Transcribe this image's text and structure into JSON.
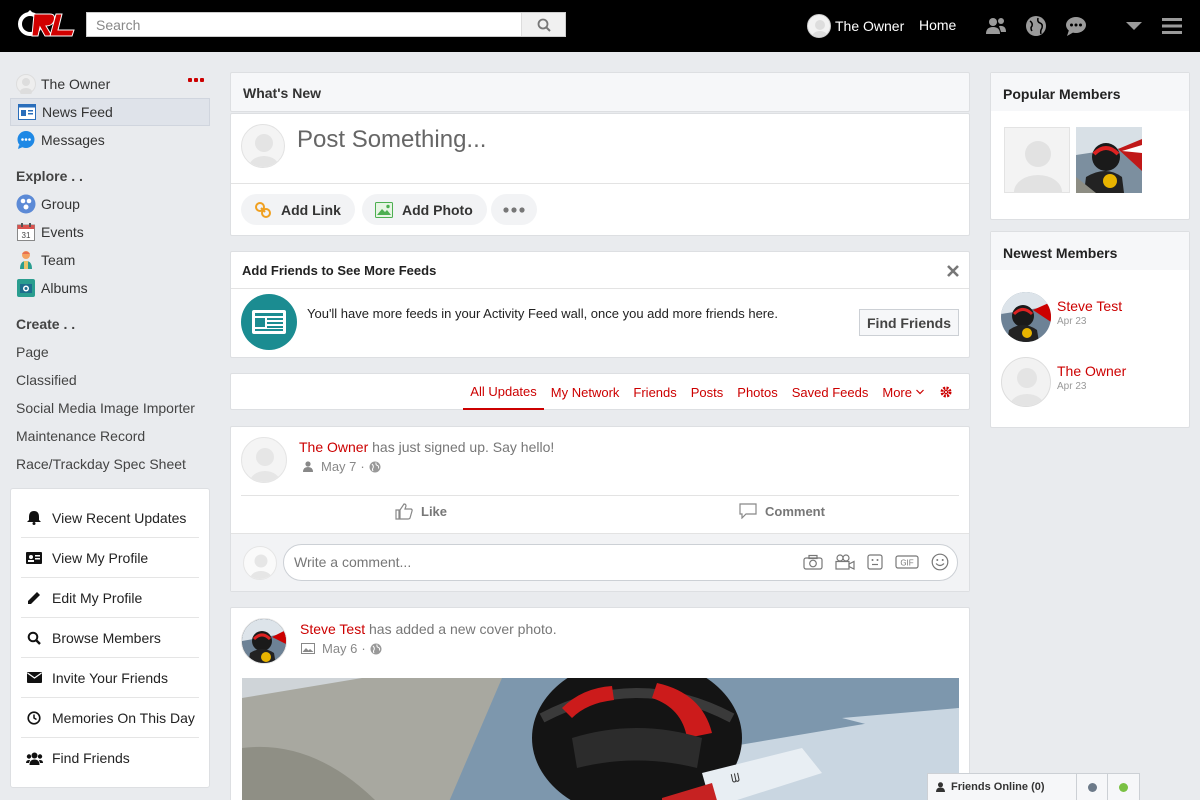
{
  "topbar": {
    "search_placeholder": "Search",
    "user_name": "The Owner",
    "home_label": "Home"
  },
  "left_nav": {
    "user_name": "The Owner",
    "items": [
      {
        "label": "News Feed",
        "icon": "news-feed-icon",
        "active": true
      },
      {
        "label": "Messages",
        "icon": "messages-icon"
      }
    ],
    "explore_heading": "Explore . .",
    "explore_items": [
      {
        "label": "Group",
        "icon": "group-icon"
      },
      {
        "label": "Events",
        "icon": "calendar-icon"
      },
      {
        "label": "Team",
        "icon": "team-icon"
      },
      {
        "label": "Albums",
        "icon": "albums-icon"
      }
    ],
    "create_heading": "Create . .",
    "create_items": [
      "Page",
      "Classified",
      "Social Media Image Importer",
      "Maintenance Record",
      "Race/Trackday Spec Sheet"
    ]
  },
  "quick_links": [
    {
      "label": "View Recent Updates",
      "icon": "bell-icon"
    },
    {
      "label": "View My Profile",
      "icon": "id-card-icon"
    },
    {
      "label": "Edit My Profile",
      "icon": "pencil-icon"
    },
    {
      "label": "Browse Members",
      "icon": "search-icon"
    },
    {
      "label": "Invite Your Friends",
      "icon": "envelope-icon"
    },
    {
      "label": "Memories On This Day",
      "icon": "clock-icon"
    },
    {
      "label": "Find Friends",
      "icon": "users-icon"
    }
  ],
  "whats_new": {
    "title": "What's New",
    "placeholder": "Post Something...",
    "add_link": "Add Link",
    "add_photo": "Add Photo"
  },
  "add_friends": {
    "title": "Add Friends to See More Feeds",
    "message": "You'll have more feeds in your Activity Feed wall, once you add more friends here.",
    "button": "Find Friends"
  },
  "feed_tabs": [
    "All Updates",
    "My Network",
    "Friends",
    "Posts",
    "Photos",
    "Saved Feeds",
    "More"
  ],
  "posts": [
    {
      "author": "The Owner",
      "text": "has just signed up. Say hello!",
      "date": "May 7",
      "like_label": "Like",
      "comment_label": "Comment",
      "comment_placeholder": "Write a comment..."
    },
    {
      "author": "Steve Test",
      "text": "has added a new cover photo.",
      "date": "May 6"
    }
  ],
  "popular_members": {
    "title": "Popular Members"
  },
  "newest_members": {
    "title": "Newest Members",
    "members": [
      {
        "name": "Steve Test",
        "date": "Apr 23"
      },
      {
        "name": "The Owner",
        "date": "Apr 23"
      }
    ]
  },
  "friends_online": {
    "label": "Friends Online (0)"
  },
  "colors": {
    "accent": "#cc0000",
    "topbar": "#000000",
    "teal": "#1b8c91",
    "online": "#7ac143",
    "away": "#6c7a89"
  }
}
